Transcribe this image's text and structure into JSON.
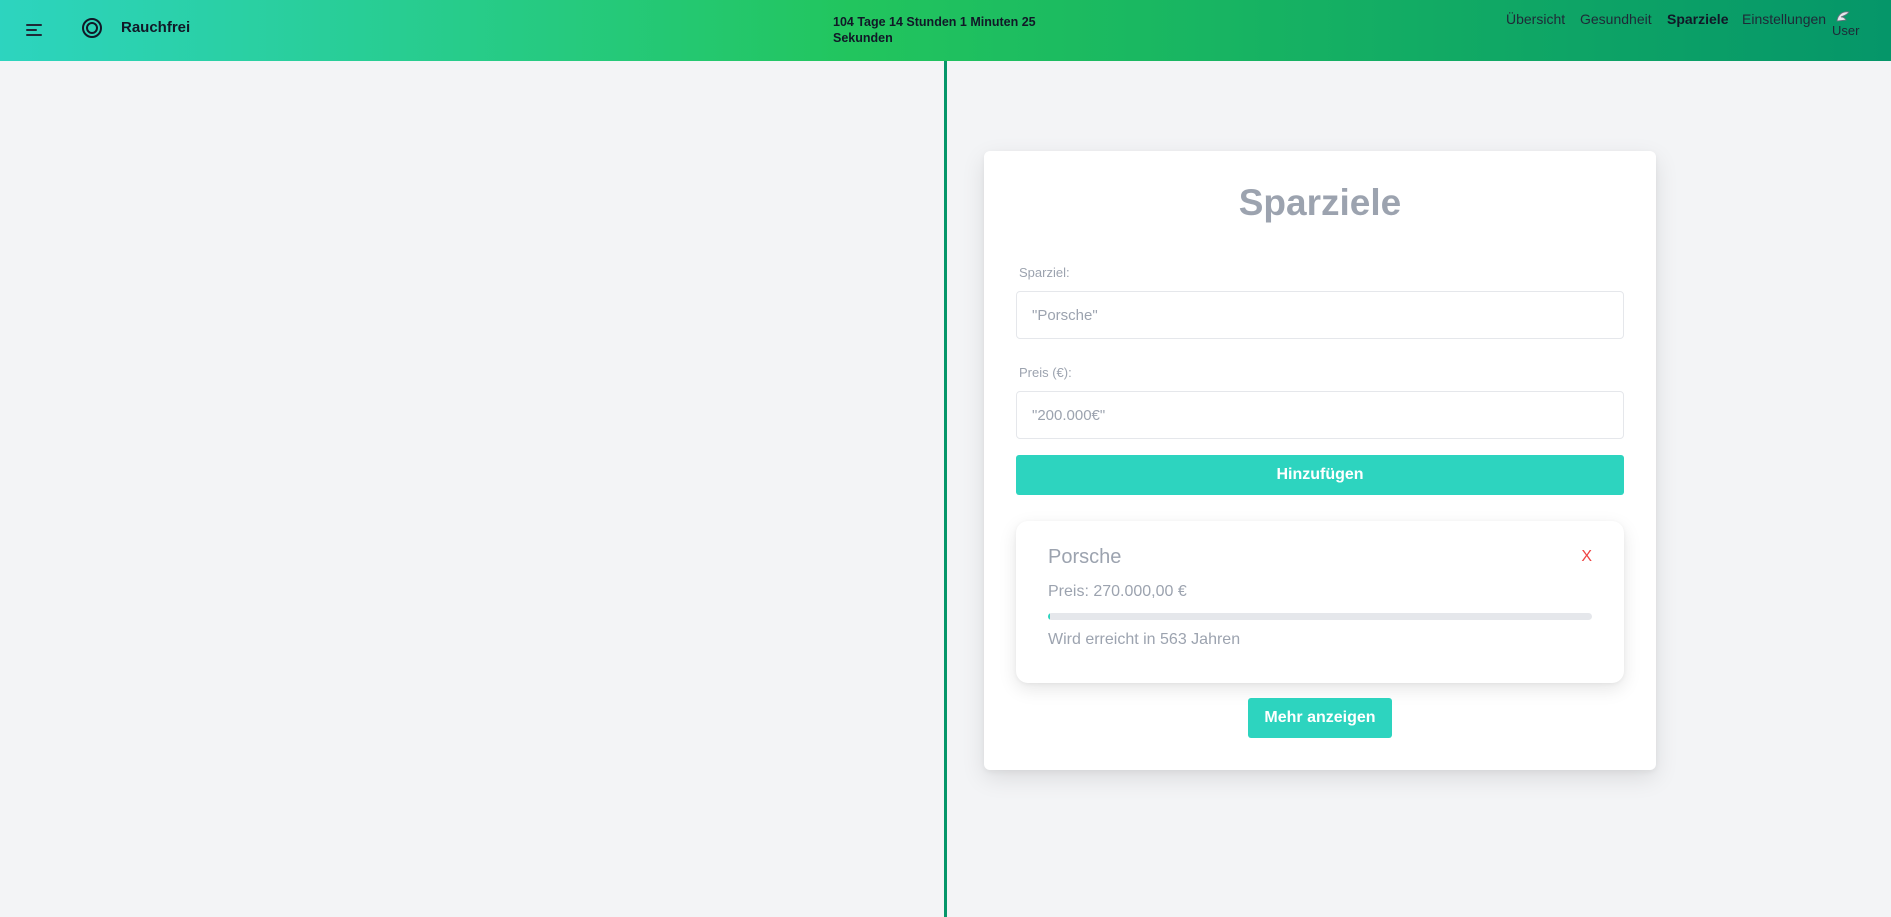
{
  "header": {
    "brand": "Rauchfrei",
    "timer": "104 Tage 14 Stunden 1 Minuten 25 Sekunden",
    "nav": [
      {
        "label": "Übersicht"
      },
      {
        "label": "Gesundheit"
      },
      {
        "label": "Sparziele"
      },
      {
        "label": "Einstellungen"
      }
    ],
    "user_label": "User"
  },
  "card": {
    "title": "Sparziele",
    "goal_label": "Sparziel:",
    "goal_placeholder": "\"Porsche\"",
    "price_label": "Preis (€):",
    "price_placeholder": "\"200.000€\"",
    "add_button": "Hinzufügen",
    "more_button": "Mehr anzeigen"
  },
  "goals": [
    {
      "name": "Porsche",
      "remove": "X",
      "price": "Preis: 270.000,00 €",
      "progress": 0.003,
      "eta": "Wird erreicht in 563 Jahren"
    }
  ],
  "colors": {
    "accent": "#2dd4bf",
    "header_start": "#2dd4bf",
    "header_mid": "#22c55e",
    "header_end": "#059669",
    "danger": "#ef4444"
  }
}
